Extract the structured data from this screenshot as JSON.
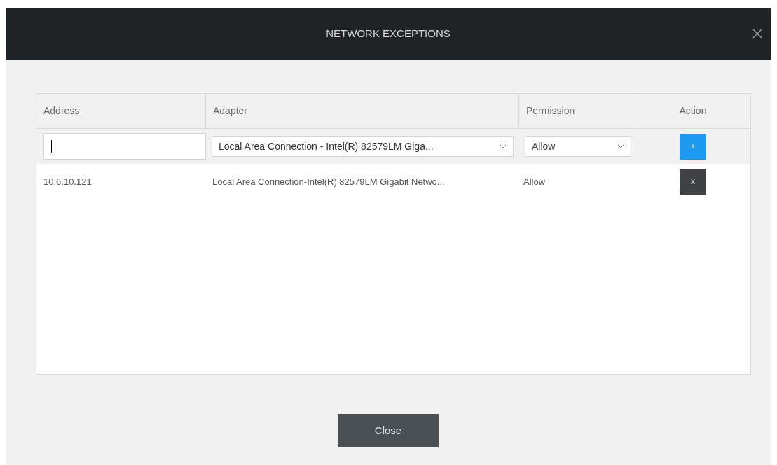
{
  "window": {
    "title": "NETWORK EXCEPTIONS"
  },
  "table": {
    "columns": [
      "Address",
      "Adapter",
      "Permission",
      "Action"
    ],
    "new_row": {
      "address": {
        "focused": true
      },
      "adapter": "Local Area Connection - Intel(R) 82579LM Giga...",
      "permission": "Allow",
      "add_button": "+"
    },
    "rows": [
      {
        "address": "10.6.10.121",
        "adapter": "Local Area Connection-Intel(R) 82579LM Gigabit Netwo...",
        "permission": "Allow",
        "remove_button": "x"
      }
    ]
  },
  "buttons": [
    "Close"
  ]
}
